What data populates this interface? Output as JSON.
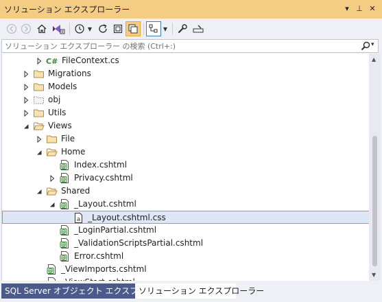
{
  "window": {
    "title": "ソリューション エクスプローラー",
    "pin_glyph": "▾",
    "autohide_glyph": "⊥",
    "close_glyph": "✕"
  },
  "toolbar": {
    "icons": [
      "back-arrow-icon",
      "forward-arrow-icon",
      "home-icon",
      "vs-switch-view-icon",
      "history-icon",
      "dropdown-arrow-icon",
      "refresh-icon",
      "collapse-all-icon",
      "show-all-files-icon",
      "preview-selected-icon",
      "dropdown-arrow-icon",
      "properties-wrench-icon",
      "preview-pane-icon"
    ]
  },
  "search": {
    "placeholder": "ソリューション エクスプローラー の検索 (Ctrl+:)",
    "dropdown_glyph": "▾"
  },
  "tree": {
    "items": [
      {
        "label": "FileContext.cs",
        "icon": "csharp-file-icon",
        "expander": "collapsed",
        "depth": 3,
        "selected": false
      },
      {
        "label": "Migrations",
        "icon": "folder-icon",
        "expander": "collapsed",
        "depth": 2,
        "selected": false
      },
      {
        "label": "Models",
        "icon": "folder-icon",
        "expander": "collapsed",
        "depth": 2,
        "selected": false
      },
      {
        "label": "obj",
        "icon": "dotted-folder-icon",
        "expander": "collapsed",
        "depth": 2,
        "selected": false
      },
      {
        "label": "Utils",
        "icon": "folder-icon",
        "expander": "collapsed",
        "depth": 2,
        "selected": false
      },
      {
        "label": "Views",
        "icon": "open-folder-icon",
        "expander": "expanded",
        "depth": 2,
        "selected": false
      },
      {
        "label": "File",
        "icon": "folder-icon",
        "expander": "collapsed",
        "depth": 3,
        "selected": false
      },
      {
        "label": "Home",
        "icon": "open-folder-icon",
        "expander": "expanded",
        "depth": 3,
        "selected": false
      },
      {
        "label": "Index.cshtml",
        "icon": "razor-file-icon",
        "expander": "none",
        "depth": 4,
        "selected": false
      },
      {
        "label": "Privacy.cshtml",
        "icon": "razor-file-icon",
        "expander": "collapsed",
        "depth": 4,
        "selected": false
      },
      {
        "label": "Shared",
        "icon": "open-folder-icon",
        "expander": "expanded",
        "depth": 3,
        "selected": false
      },
      {
        "label": "_Layout.cshtml",
        "icon": "razor-file-icon",
        "expander": "expanded",
        "depth": 4,
        "selected": false
      },
      {
        "label": "_Layout.cshtml.css",
        "icon": "css-file-icon",
        "expander": "none",
        "depth": 5,
        "selected": true
      },
      {
        "label": "_LoginPartial.cshtml",
        "icon": "razor-file-icon",
        "expander": "none",
        "depth": 4,
        "selected": false
      },
      {
        "label": "_ValidationScriptsPartial.cshtml",
        "icon": "razor-file-icon",
        "expander": "none",
        "depth": 4,
        "selected": false
      },
      {
        "label": "Error.cshtml",
        "icon": "razor-file-icon",
        "expander": "none",
        "depth": 4,
        "selected": false
      },
      {
        "label": "_ViewImports.cshtml",
        "icon": "razor-file-icon",
        "expander": "none",
        "depth": 3,
        "selected": false
      },
      {
        "label": "_ViewStart.cshtml",
        "icon": "razor-file-icon",
        "expander": "none",
        "depth": 3,
        "selected": false
      }
    ]
  },
  "bottom_tabs": [
    {
      "label": "SQL Server オブジェクト エクスプローラー",
      "active": false
    },
    {
      "label": "ソリューション エクスプローラー",
      "active": true
    }
  ],
  "colors": {
    "title_bar": "#f5cc84",
    "selected_row_bg": "#dfe7f7",
    "selected_row_border": "#7a9fd9",
    "folder": "#dcb67a",
    "razor_green": "#388a34",
    "inactive_tab": "#4b5a8a"
  }
}
